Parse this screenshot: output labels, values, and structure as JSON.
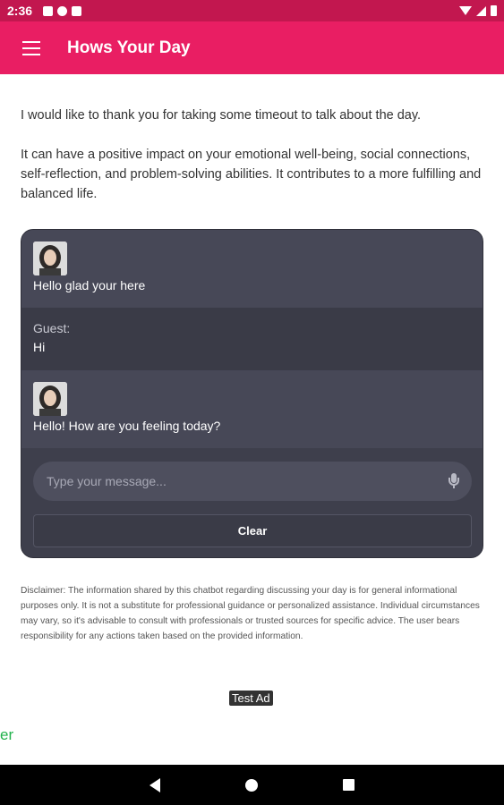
{
  "status_bar": {
    "time": "2:36"
  },
  "app_bar": {
    "title": "Hows Your Day",
    "menu_icon": "hamburger-menu-icon"
  },
  "intro": {
    "paragraph_1": "I would like to thank you for taking some timeout to talk about the day.",
    "paragraph_2": "It can have a positive impact on your emotional well-being, social connections, self-reflection, and problem-solving abilities. It contributes to a more fulfilling and balanced life."
  },
  "chat": {
    "messages": [
      {
        "sender": "bot",
        "text": "Hello glad your here"
      },
      {
        "sender": "guest",
        "label": "Guest:",
        "text": "Hi"
      },
      {
        "sender": "bot",
        "text": "Hello! How are you feeling today?"
      }
    ],
    "input": {
      "placeholder": "Type your message..."
    },
    "clear_label": "Clear"
  },
  "disclaimer": "Disclaimer: The information shared by this chatbot regarding discussing your day is for general informational purposes only. It is not a substitute for professional guidance or personalized assistance. Individual circumstances may vary, so it's advisable to consult with professionals or trusted sources for specific advice. The user bears responsibility for any actions taken based on the provided information.",
  "ad": {
    "label": "Test Ad",
    "snippet": "er"
  },
  "colors": {
    "primary": "#e91e63",
    "status_bar": "#c2174f",
    "chat_bg": "#3e3f4c"
  }
}
